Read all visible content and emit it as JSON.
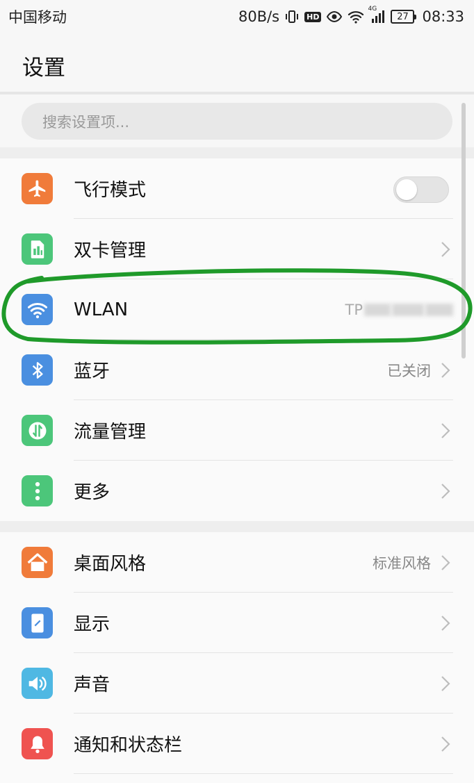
{
  "status_bar": {
    "carrier": "中国移动",
    "speed": "80B/s",
    "hd": "HD",
    "network": "4G",
    "battery": "27",
    "time": "08:33"
  },
  "header": {
    "title": "设置"
  },
  "search": {
    "placeholder": "搜索设置项..."
  },
  "section1": {
    "items": [
      {
        "label": "飞行模式",
        "icon": "airplane-icon",
        "color": "#f07b3a",
        "control": "toggle",
        "toggle_on": false
      },
      {
        "label": "双卡管理",
        "icon": "sim-card-icon",
        "color": "#4cc67a"
      },
      {
        "label": "WLAN",
        "icon": "wifi-icon",
        "color": "#4a8fe0",
        "value": "TP"
      },
      {
        "label": "蓝牙",
        "icon": "bluetooth-icon",
        "color": "#4a8fe0",
        "value": "已关闭"
      },
      {
        "label": "流量管理",
        "icon": "data-usage-icon",
        "color": "#4cc67a"
      },
      {
        "label": "更多",
        "icon": "more-icon",
        "color": "#4cc67a"
      }
    ]
  },
  "section2": {
    "items": [
      {
        "label": "桌面风格",
        "icon": "home-icon",
        "color": "#f07b3a",
        "value": "标准风格"
      },
      {
        "label": "显示",
        "icon": "display-icon",
        "color": "#4a8fe0"
      },
      {
        "label": "声音",
        "icon": "speaker-icon",
        "color": "#4fb8e3"
      },
      {
        "label": "通知和状态栏",
        "icon": "bell-icon",
        "color": "#ef5350"
      }
    ]
  },
  "annotation": {
    "color": "#1f9a2a"
  }
}
